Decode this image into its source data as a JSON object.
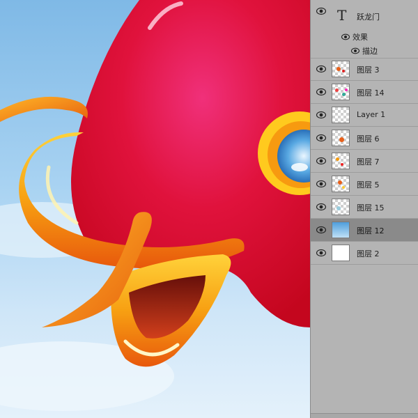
{
  "layers_panel": {
    "text_layer": {
      "type_glyph": "T",
      "name": "跃龙门",
      "effects_label": "效果",
      "stroke_label": "描边"
    },
    "layers": [
      {
        "name": "图层 3",
        "thumb": "transparent",
        "selected": false
      },
      {
        "name": "图层 14",
        "thumb": "transparent",
        "selected": false
      },
      {
        "name": "Layer 1",
        "thumb": "transparent",
        "selected": false
      },
      {
        "name": "图层 6",
        "thumb": "transparent",
        "selected": false
      },
      {
        "name": "图层 7",
        "thumb": "transparent",
        "selected": false
      },
      {
        "name": "图层 5",
        "thumb": "transparent",
        "selected": false
      },
      {
        "name": "图层 15",
        "thumb": "transparent",
        "selected": false
      },
      {
        "name": "图层 12",
        "thumb": "sky",
        "selected": true
      },
      {
        "name": "图层 2",
        "thumb": "white",
        "selected": false
      }
    ]
  },
  "icons": {
    "visibility": "eye-icon",
    "text_layer": "text-type-icon"
  },
  "colors": {
    "panel_bg": "#b4b4b4",
    "selected_row": "#8a8a8a",
    "fish_body": "#e0103a",
    "fish_lip": "#f39a10",
    "sky": "#a9d3f2"
  }
}
